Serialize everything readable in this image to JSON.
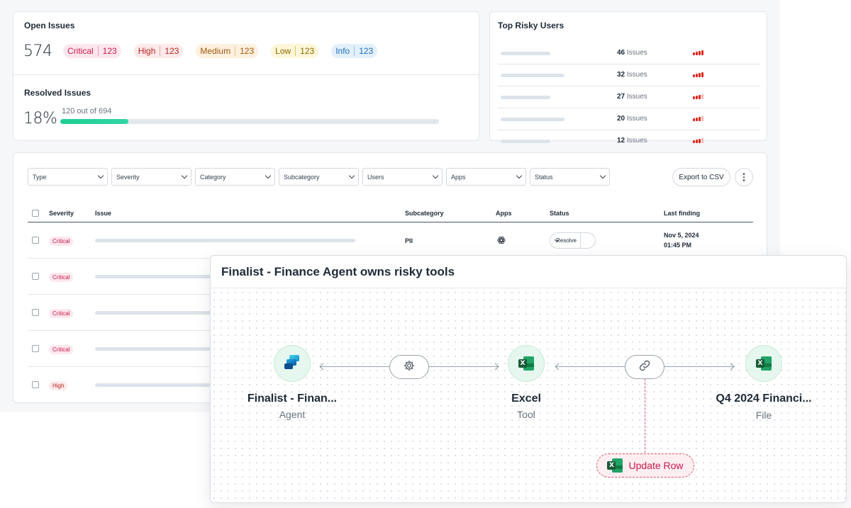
{
  "open_issues": {
    "title": "Open Issues",
    "count": "574",
    "severities": [
      {
        "label": "Critical",
        "count": "123"
      },
      {
        "label": "High",
        "count": "123"
      },
      {
        "label": "Medium",
        "count": "123"
      },
      {
        "label": "Low",
        "count": "123"
      },
      {
        "label": "Info",
        "count": "123"
      }
    ]
  },
  "resolved_issues": {
    "title": "Resolved Issues",
    "percent": "18%",
    "subtitle": "120 out of 694",
    "progress_fraction": 0.18
  },
  "top_risky_users": {
    "title": "Top Risky Users",
    "issues_suffix": "Issues",
    "rows": [
      {
        "count": "46",
        "risk_level": 4
      },
      {
        "count": "32",
        "risk_level": 4
      },
      {
        "count": "27",
        "risk_level": 3
      },
      {
        "count": "20",
        "risk_level": 3
      },
      {
        "count": "12",
        "risk_level": 3
      }
    ]
  },
  "filters": [
    "Type",
    "Severity",
    "Category",
    "Subcategory",
    "Users",
    "Apps",
    "Status"
  ],
  "toolbar": {
    "export_label": "Export to CSV"
  },
  "table": {
    "headers": {
      "severity": "Severity",
      "issue": "Issue",
      "subcategory": "Subcategory",
      "apps": "Apps",
      "status": "Status",
      "last_finding": "Last finding"
    },
    "rows": [
      {
        "severity": "Critical",
        "subcategory": "PII",
        "app_icon": "openai-icon",
        "status": "Resolve",
        "date": "Nov 5, 2024",
        "time": "01:45 PM"
      },
      {
        "severity": "Critical"
      },
      {
        "severity": "Critical"
      },
      {
        "severity": "Critical"
      },
      {
        "severity": "High"
      }
    ]
  },
  "graph": {
    "title": "Finalist - Finance Agent owns risky tools",
    "nodes": [
      {
        "name": "Finalist - Finan...",
        "type": "Agent",
        "icon": "agent-app-icon"
      },
      {
        "name": "Excel",
        "type": "Tool",
        "icon": "excel-icon"
      },
      {
        "name": "Q4 2024 Financi...",
        "type": "File",
        "icon": "excel-icon"
      }
    ],
    "edges": [
      {
        "icon": "gear-icon"
      },
      {
        "icon": "link-icon"
      }
    ],
    "action": {
      "label": "Update Row",
      "icon": "excel-icon"
    }
  },
  "colors": {
    "critical": "#c9184a",
    "high": "#b4231f",
    "medium": "#a3570b",
    "low": "#8a6a00",
    "info": "#1f6fbf",
    "progress": "#1ccf94",
    "risk_bar_active": "#e0281f",
    "risk_bar_inactive": "#f3b7b3"
  }
}
